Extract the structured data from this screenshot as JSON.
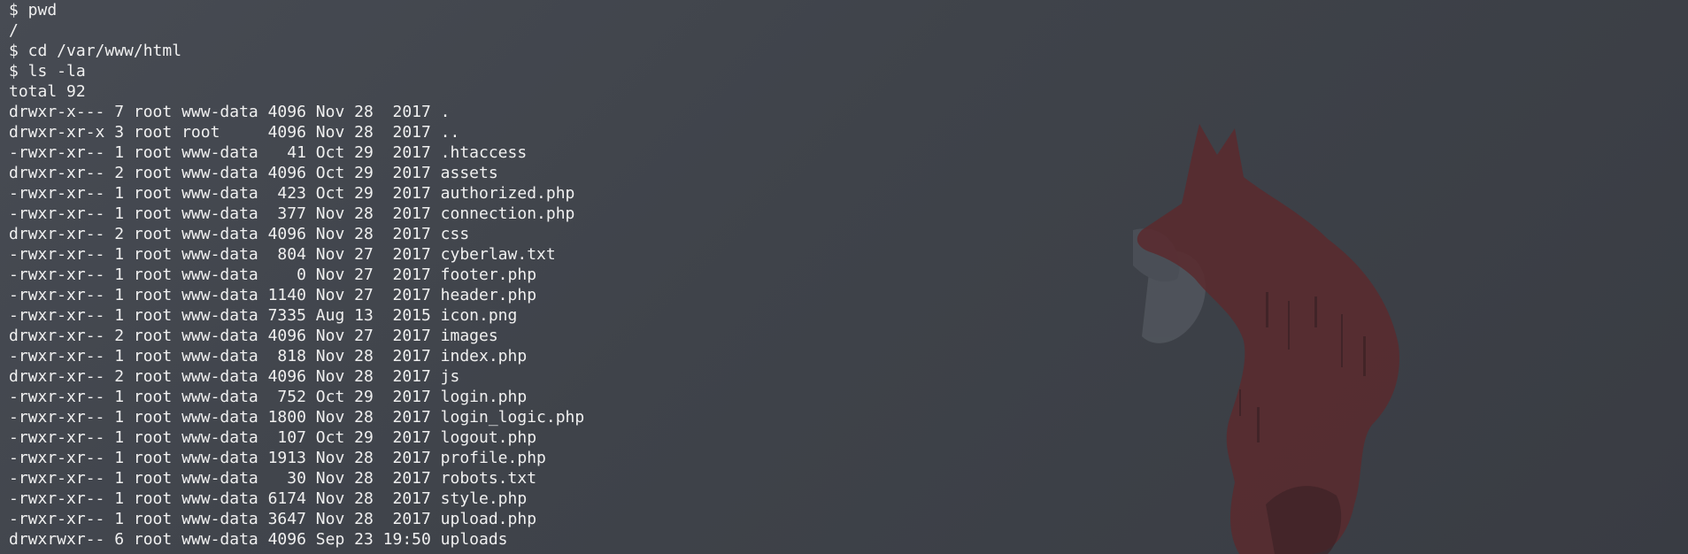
{
  "terminal": {
    "lines": [
      "$ pwd",
      "/",
      "$ cd /var/www/html",
      "$ ls -la",
      "total 92",
      "drwxr-x--- 7 root www-data 4096 Nov 28  2017 .",
      "drwxr-xr-x 3 root root     4096 Nov 28  2017 ..",
      "-rwxr-xr-- 1 root www-data   41 Oct 29  2017 .htaccess",
      "drwxr-xr-- 2 root www-data 4096 Oct 29  2017 assets",
      "-rwxr-xr-- 1 root www-data  423 Oct 29  2017 authorized.php",
      "-rwxr-xr-- 1 root www-data  377 Nov 28  2017 connection.php",
      "drwxr-xr-- 2 root www-data 4096 Nov 28  2017 css",
      "-rwxr-xr-- 1 root www-data  804 Nov 27  2017 cyberlaw.txt",
      "-rwxr-xr-- 1 root www-data    0 Nov 27  2017 footer.php",
      "-rwxr-xr-- 1 root www-data 1140 Nov 27  2017 header.php",
      "-rwxr-xr-- 1 root www-data 7335 Aug 13  2015 icon.png",
      "drwxr-xr-- 2 root www-data 4096 Nov 27  2017 images",
      "-rwxr-xr-- 1 root www-data  818 Nov 28  2017 index.php",
      "drwxr-xr-- 2 root www-data 4096 Nov 28  2017 js",
      "-rwxr-xr-- 1 root www-data  752 Oct 29  2017 login.php",
      "-rwxr-xr-- 1 root www-data 1800 Nov 28  2017 login_logic.php",
      "-rwxr-xr-- 1 root www-data  107 Oct 29  2017 logout.php",
      "-rwxr-xr-- 1 root www-data 1913 Nov 28  2017 profile.php",
      "-rwxr-xr-- 1 root www-data   30 Nov 28  2017 robots.txt",
      "-rwxr-xr-- 1 root www-data 6174 Nov 28  2017 style.php",
      "-rwxr-xr-- 1 root www-data 3647 Nov 28  2017 upload.php",
      "drwxrwxr-- 6 root www-data 4096 Sep 23 19:50 uploads"
    ]
  },
  "wallpaper": {
    "icon": "fox-silhouette-icon",
    "colors": {
      "background": "#42464d",
      "fox": "#5a2a2e",
      "fox_dark": "#3d2226",
      "mist": "#6b7077"
    }
  }
}
